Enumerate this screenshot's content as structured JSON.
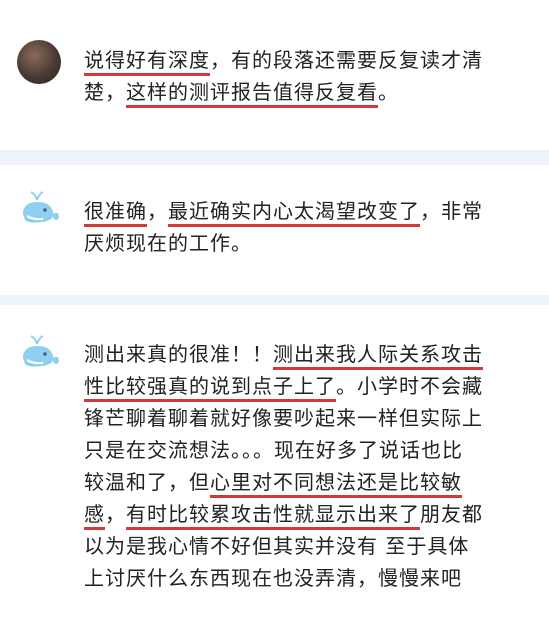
{
  "comments": [
    {
      "lines": [
        [
          {
            "t": "说得好有深度",
            "hl": true
          },
          {
            "t": "，有的段落还需要反复读才清",
            "hl": false
          }
        ],
        [
          {
            "t": "楚，",
            "hl": false
          },
          {
            "t": "这样的测评报告值得反复看",
            "hl": true
          },
          {
            "t": "。",
            "hl": false
          }
        ]
      ]
    },
    {
      "lines": [
        [
          {
            "t": "很准确",
            "hl": true
          },
          {
            "t": "，",
            "hl": false
          },
          {
            "t": "最近确实内心太渴望改变了",
            "hl": true
          },
          {
            "t": "，非常",
            "hl": false
          }
        ],
        [
          {
            "t": "厌烦现在的工作。",
            "hl": false
          }
        ]
      ]
    },
    {
      "lines": [
        [
          {
            "t": "测出来真的很准！！",
            "hl": false
          },
          {
            "t": "测出来我人际关系攻击",
            "hl": true
          }
        ],
        [
          {
            "t": "性比较强真的说到点子上了",
            "hl": true
          },
          {
            "t": "。小学时不会藏",
            "hl": false
          }
        ],
        [
          {
            "t": "锋芒聊着聊着就好像要吵起来一样但实际上",
            "hl": false
          }
        ],
        [
          {
            "t": "只是在交流想法。。。现在好多了说话也比",
            "hl": false
          }
        ],
        [
          {
            "t": "较温和了，但",
            "hl": false
          },
          {
            "t": "心里对不同想法还是比较敏",
            "hl": true
          }
        ],
        [
          {
            "t": "感",
            "hl": true
          },
          {
            "t": "，",
            "hl": false
          },
          {
            "t": "有时比较累攻击性就显示出来了",
            "hl": true
          },
          {
            "t": "朋友都",
            "hl": false
          }
        ],
        [
          {
            "t": "以为是我心情不好但其实并没有 至于具体",
            "hl": false
          }
        ],
        [
          {
            "t": "上讨厌什么东西现在也没弄清，慢慢来吧",
            "hl": false
          }
        ]
      ]
    }
  ],
  "avatars": [
    "photo-avatar",
    "whale-avatar",
    "whale-avatar"
  ]
}
